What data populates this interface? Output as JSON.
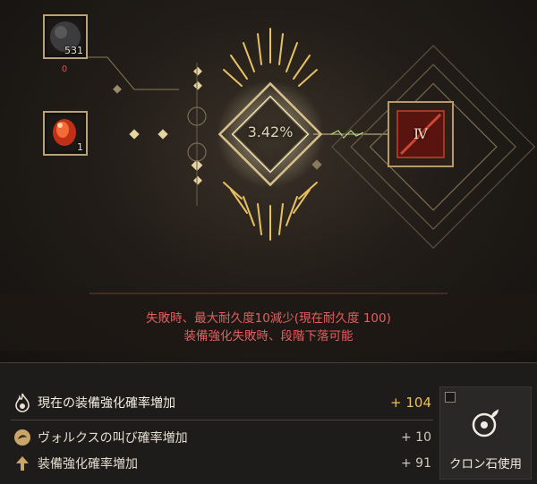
{
  "materials": {
    "black_stone": {
      "count": "531",
      "below": "0"
    },
    "crystal": {
      "count": "1"
    }
  },
  "enhance": {
    "success_rate": "3.42%",
    "target_level": "Ⅳ"
  },
  "warnings": [
    "失敗時、最大耐久度10減少(現在耐久度 100)",
    "装備強化失敗時、段階下落可能"
  ],
  "bonuses": {
    "total": {
      "label": "現在の装備強化確率増加",
      "value": "+ 104"
    },
    "volks": {
      "label": "ヴォルクスの叫び確率増加",
      "value": "+ 10"
    },
    "stack": {
      "label": "装備強化確率増加",
      "value": "+ 91"
    }
  },
  "cron": {
    "label": "クロン石使用",
    "checked": false
  },
  "colors": {
    "gold": "#d8b878",
    "warn_red": "#e06060",
    "total_value": "#e8c060"
  },
  "icons": [
    "black-stone-icon",
    "crystal-icon",
    "flame-icon",
    "volks-icon",
    "arrow-up-icon",
    "cron-stone-icon"
  ]
}
